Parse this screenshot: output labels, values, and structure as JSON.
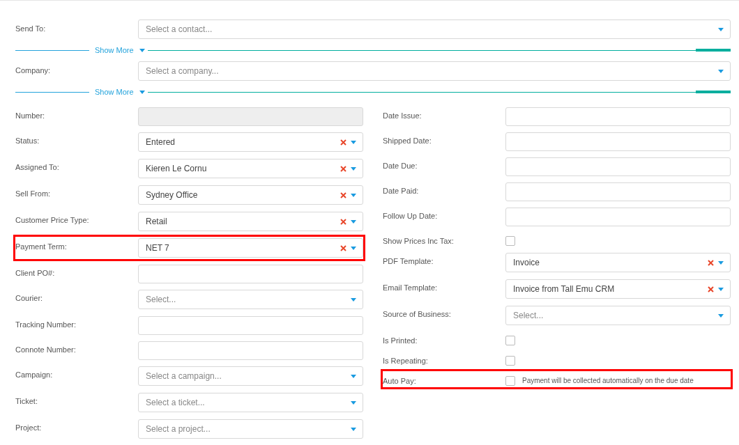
{
  "top_rows": [
    {
      "kind": "select",
      "label": "Send To:",
      "placeholder": "Select a contact...",
      "clearable": false
    },
    {
      "kind": "divider",
      "label": "Show More"
    },
    {
      "kind": "select",
      "label": "Company:",
      "placeholder": "Select a company...",
      "clearable": false
    },
    {
      "kind": "divider",
      "label": "Show More"
    }
  ],
  "left_rows": [
    {
      "kind": "readonly",
      "label": "Number:",
      "highlighted": false
    },
    {
      "kind": "select",
      "label": "Status:",
      "value": "Entered",
      "clearable": true,
      "highlighted": false
    },
    {
      "kind": "select",
      "label": "Assigned To:",
      "value": "Kieren Le Cornu",
      "clearable": true,
      "highlighted": false
    },
    {
      "kind": "select",
      "label": "Sell From:",
      "value": "Sydney Office",
      "clearable": true,
      "highlighted": false
    },
    {
      "kind": "select",
      "label": "Customer Price Type:",
      "value": "Retail",
      "clearable": true,
      "highlighted": false
    },
    {
      "kind": "select",
      "label": "Payment Term:",
      "value": "NET 7",
      "clearable": true,
      "highlighted": true
    },
    {
      "kind": "text",
      "label": "Client PO#:",
      "highlighted": false
    },
    {
      "kind": "select",
      "label": "Courier:",
      "placeholder": "Select...",
      "clearable": false,
      "highlighted": false
    },
    {
      "kind": "text",
      "label": "Tracking Number:",
      "highlighted": false
    },
    {
      "kind": "text",
      "label": "Connote Number:",
      "highlighted": false
    },
    {
      "kind": "select",
      "label": "Campaign:",
      "placeholder": "Select a campaign...",
      "clearable": false,
      "highlighted": false
    },
    {
      "kind": "select",
      "label": "Ticket:",
      "placeholder": "Select a ticket...",
      "clearable": false,
      "highlighted": false
    },
    {
      "kind": "select",
      "label": "Project:",
      "placeholder": "Select a project...",
      "clearable": false,
      "highlighted": false
    }
  ],
  "right_rows": [
    {
      "kind": "text",
      "label": "Date Issue:",
      "highlighted": false
    },
    {
      "kind": "text",
      "label": "Shipped Date:",
      "highlighted": false
    },
    {
      "kind": "text",
      "label": "Date Due:",
      "highlighted": false
    },
    {
      "kind": "text",
      "label": "Date Paid:",
      "highlighted": false
    },
    {
      "kind": "text",
      "label": "Follow Up Date:",
      "highlighted": false
    },
    {
      "kind": "checkbox",
      "label": "Show Prices Inc Tax:",
      "checked": false,
      "highlighted": false
    },
    {
      "kind": "select",
      "label": "PDF Template:",
      "value": "Invoice",
      "clearable": true,
      "highlighted": false
    },
    {
      "kind": "select",
      "label": "Email Template:",
      "value": "Invoice from Tall Emu CRM",
      "clearable": true,
      "highlighted": false
    },
    {
      "kind": "select",
      "label": "Source of Business:",
      "placeholder": "Select...",
      "clearable": false,
      "highlighted": false
    },
    {
      "kind": "checkbox",
      "label": "Is Printed:",
      "checked": false,
      "highlighted": false
    },
    {
      "kind": "checkbox",
      "label": "Is Repeating:",
      "checked": false,
      "highlighted": false
    },
    {
      "kind": "checkbox",
      "label": "Auto Pay:",
      "checked": false,
      "note": "Payment will be collected automatically on the due date",
      "highlighted": true
    }
  ]
}
